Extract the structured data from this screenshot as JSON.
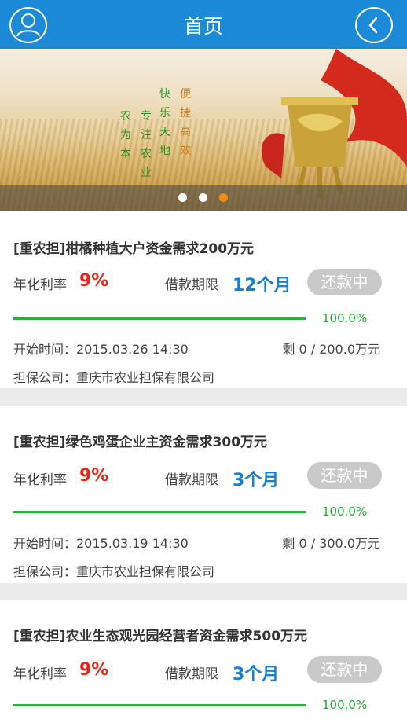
{
  "header": {
    "title": "首页",
    "user_icon": "user-icon",
    "back_icon": "back-chevron-icon",
    "color": "#1d8ad8"
  },
  "banner": {
    "slogan_columns": [
      "农为本",
      "专注农业",
      "快乐天地",
      "便捷高效"
    ],
    "current_slide": 3,
    "slide_count": 3
  },
  "labels": {
    "rate": "年化利率",
    "term": "借款期限"
  },
  "loans": [
    {
      "title": "[重农担]柑橘种植大户资金需求200万元",
      "rate": "9%",
      "term": "12个月",
      "status": "还款中",
      "progress": 1.0,
      "progress_text": "100.0%",
      "start_time": "开始时间：2015.03.26 14:30",
      "remaining": "剩 0 / 200.0万元",
      "guarantor": "担保公司：重庆市农业担保有限公司"
    },
    {
      "title": "[重农担]绿色鸡蛋企业主资金需求300万元",
      "rate": "9%",
      "term": "3个月",
      "status": "还款中",
      "progress": 1.0,
      "progress_text": "100.0%",
      "start_time": "开始时间：2015.03.19 14:30",
      "remaining": "剩 0 / 300.0万元",
      "guarantor": "担保公司：重庆市农业担保有限公司"
    },
    {
      "title": "[重农担]农业生态观光园经营者资金需求500万元",
      "rate": "9%",
      "term": "3个月",
      "status": "还款中",
      "progress": 1.0,
      "progress_text": "100.0%"
    }
  ]
}
